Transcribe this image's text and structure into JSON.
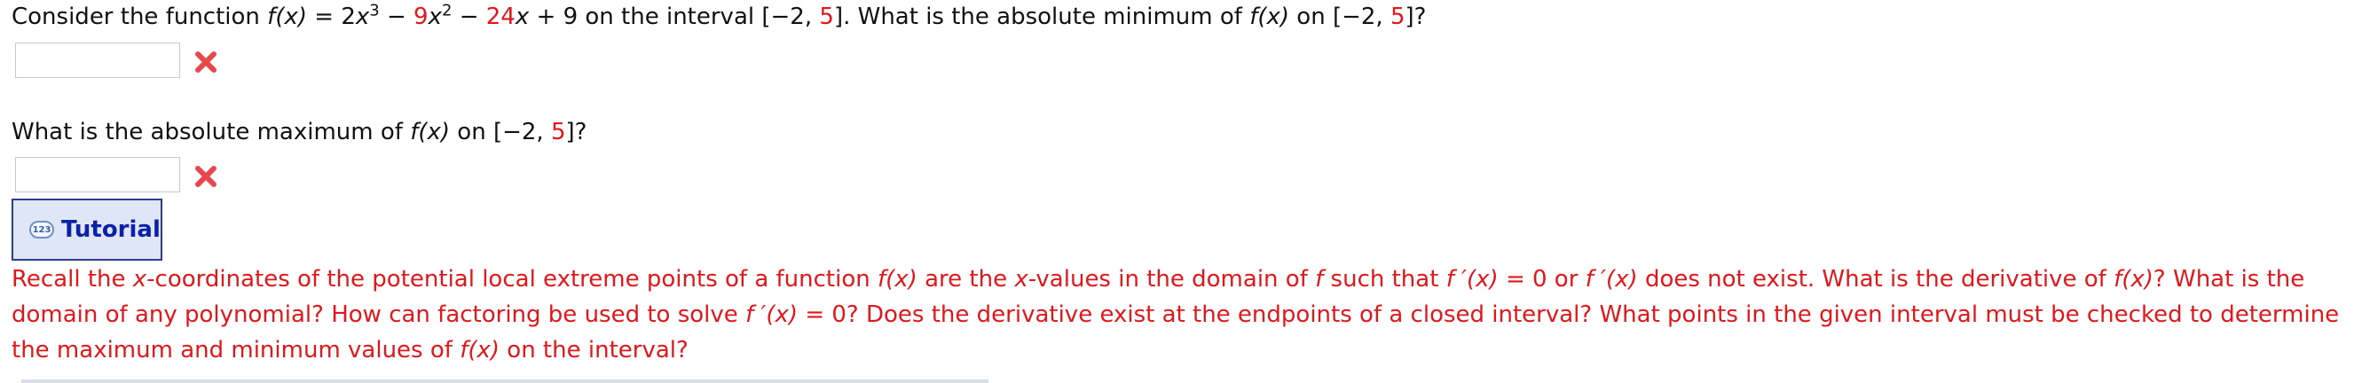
{
  "question1": {
    "prefix": "Consider the function",
    "fx": "f(x)",
    "eq": "=",
    "coef_a": "2",
    "var_x": "x",
    "exp_3": "3",
    "minus1": "−",
    "coef_b": "9",
    "exp_2": "2",
    "minus2": "−",
    "coef_c": "24",
    "plus": "+",
    "const": "9",
    "on_interval": "on the interval",
    "int_open": "[−2,",
    "int_b": "5",
    "int_close": "].",
    "ask": "What is the absolute minimum of",
    "fx2": "f(x)",
    "on": "on",
    "int2_open": "[−2,",
    "int2_b": "5",
    "int2_close": "]?"
  },
  "question2": {
    "ask": "What is the absolute maximum of",
    "fx": "f(x)",
    "on": "on",
    "int_open": "[−2,",
    "int_b": "5",
    "int_close": "]?"
  },
  "answers": {
    "min_value": "",
    "max_value": ""
  },
  "status_icons": [
    "close-icon",
    "close-icon"
  ],
  "tutorial": {
    "icon_text": "123",
    "label": "Tutorial"
  },
  "hint": {
    "line1_a": "Recall the",
    "line1_x": "x",
    "line1_b": "-coordinates of the potential local extreme points of a function",
    "line1_fx": "f(x)",
    "line1_c": "are the",
    "line1_x2": "x",
    "line1_d": "-values in the domain of",
    "line1_f": "f",
    "line1_e": "such that",
    "line1_fp": "f ′(x)",
    "line1_f2": "= 0 or",
    "line1_fp2": "f ′(x)",
    "line1_g": "does not exist. What is the derivative of",
    "line1_fx3": "f(x)",
    "line1_h": "? What is the",
    "line2_a": "domain of any polynomial? How can factoring be used to solve",
    "line2_fp": "f ′(x)",
    "line2_b": "= 0? Does the derivative exist at the endpoints of a closed interval? What points in the given interval must be checked to determine",
    "line3_a": "the maximum and minimum values of",
    "line3_fx": "f(x)",
    "line3_b": "on the interval?"
  },
  "colors": {
    "red": "#e0171b",
    "tutorial_bg": "#dfe6f5",
    "tutorial_border": "#2a3d8f",
    "tutorial_text": "#0b22a8"
  }
}
